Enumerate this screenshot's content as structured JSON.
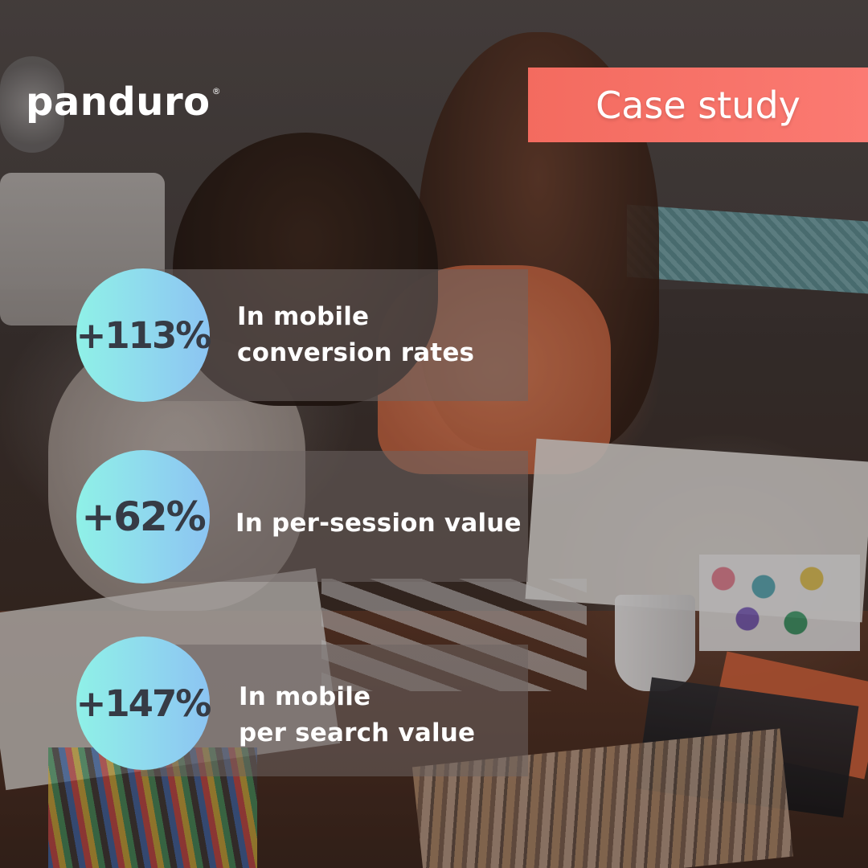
{
  "brand": {
    "name": "panduro",
    "mark": "®"
  },
  "badge": {
    "label": "Case study"
  },
  "stats": [
    {
      "value": "+113%",
      "lines": [
        "In mobile",
        "conversion rates"
      ]
    },
    {
      "value": "+62%",
      "lines": [
        "In per-session value"
      ]
    },
    {
      "value": "+147%",
      "lines": [
        "In mobile",
        "per search value"
      ]
    }
  ],
  "colors": {
    "badge_start": "#f36b5f",
    "badge_end": "#fb7a72",
    "circle_start": "#8ff1e7",
    "circle_end": "#8cc4f2",
    "circle_text": "#363b45",
    "text": "#ffffff"
  }
}
